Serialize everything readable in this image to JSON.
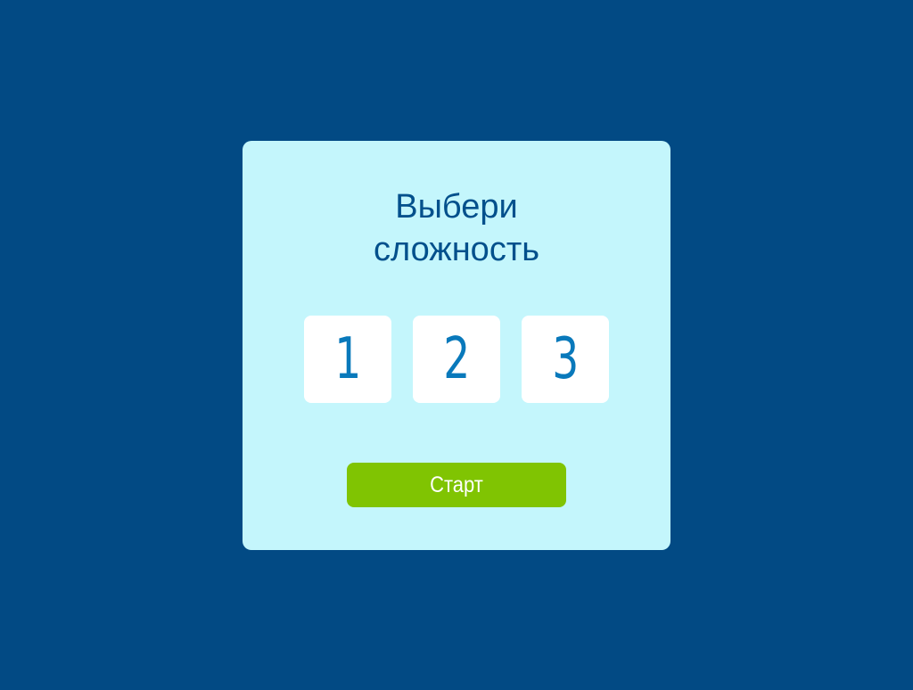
{
  "colors": {
    "background": "#024a84",
    "dialog": "#c4f6fc",
    "title": "#02508c",
    "level_text": "#0979bb",
    "level_tile": "#ffffff",
    "start_button": "#80c402",
    "start_text": "#ffffff"
  },
  "dialog": {
    "title_line_1": "Выбери",
    "title_line_2": "сложность",
    "levels": [
      {
        "label": "1"
      },
      {
        "label": "2"
      },
      {
        "label": "3"
      }
    ],
    "start_label": "Старт"
  }
}
